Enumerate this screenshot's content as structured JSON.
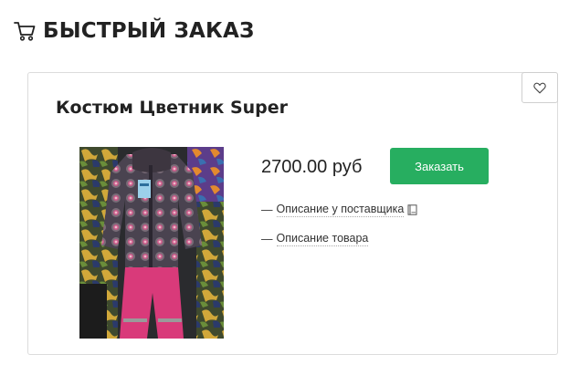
{
  "header": {
    "title": "БЫСТРЫЙ ЗАКАЗ",
    "icon": "cart-icon"
  },
  "product": {
    "title": "Костюм Цветник Super",
    "price": "2700.00 руб",
    "order_button_label": "Заказать",
    "supplier_link_prefix": "—",
    "supplier_link": "Описание у поставщика",
    "supplier_link_icon": "book-icon",
    "description_link_prefix": "—",
    "description_link": "Описание товара",
    "favorite_icon": "heart-icon",
    "image_alt": "product-photo"
  },
  "colors": {
    "accent": "#27ae60",
    "text": "#222222",
    "border": "#dcdcdc"
  }
}
